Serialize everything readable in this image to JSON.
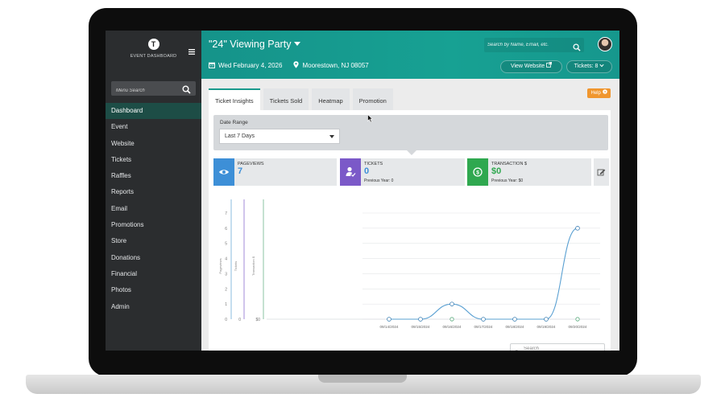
{
  "colors": {
    "accent_teal": "#17a193",
    "sidebar_bg": "#2b2d2f",
    "active_nav": "#1d4d46",
    "pageviews_blue": "#3d8fd7",
    "tickets_purple": "#7b59c8",
    "transaction_green": "#2fa84f",
    "help_orange": "#f0962e",
    "line_blue": "#5aa0d2",
    "marker_green": "#5aaa7c"
  },
  "sidebar": {
    "brand_letter": "T",
    "brand_text": "EVENT DASHBOARD",
    "menu_search_placeholder": "Menu Search",
    "items": [
      {
        "label": "Dashboard",
        "active": true
      },
      {
        "label": "Event"
      },
      {
        "label": "Website"
      },
      {
        "label": "Tickets"
      },
      {
        "label": "Raffles"
      },
      {
        "label": "Reports"
      },
      {
        "label": "Email"
      },
      {
        "label": "Promotions"
      },
      {
        "label": "Store"
      },
      {
        "label": "Donations"
      },
      {
        "label": "Financial"
      },
      {
        "label": "Photos"
      },
      {
        "label": "Admin"
      }
    ]
  },
  "header": {
    "event_title": "\"24\" Viewing Party",
    "date": "Wed February 4, 2026",
    "location": "Moorestown, NJ 08057",
    "search_placeholder": "Search by Name, Email, etc.",
    "view_website_label": "View Website",
    "tickets_label": "Tickets: 8"
  },
  "tabs": [
    {
      "label": "Ticket Insights",
      "active": true
    },
    {
      "label": "Tickets Sold"
    },
    {
      "label": "Heatmap"
    },
    {
      "label": "Promotion"
    }
  ],
  "help_label": "Help",
  "date_range": {
    "label": "Date Range",
    "selected": "Last 7 Days"
  },
  "stats": {
    "pageviews": {
      "label": "PAGEVIEWS",
      "value": "7"
    },
    "tickets": {
      "label": "TICKETS",
      "value": "0",
      "previous": "Previous Year: 0"
    },
    "transaction": {
      "label": "TRANSACTION $",
      "value": "$0",
      "previous": "Previous Year: $0"
    }
  },
  "table_search_placeholder": "Search",
  "chart_data": {
    "type": "line",
    "x": [
      "09/14/2024",
      "09/15/2024",
      "09/16/2024",
      "09/17/2024",
      "09/18/2024",
      "09/19/2024",
      "09/20/2024"
    ],
    "series": [
      {
        "name": "Pageviews",
        "values": [
          0,
          0,
          1,
          0,
          0,
          0,
          6
        ]
      },
      {
        "name": "Tickets",
        "values": [
          0,
          0,
          0,
          0,
          0,
          0,
          0
        ]
      },
      {
        "name": "Transaction $",
        "values": [
          0,
          0,
          0,
          0,
          0,
          0,
          0
        ]
      }
    ],
    "y_axes": [
      {
        "label": "Pageviews",
        "ticks": [
          "0",
          "1",
          "2",
          "3",
          "4",
          "5",
          "6",
          "7"
        ]
      },
      {
        "label": "Tickets",
        "ticks": [
          "0"
        ]
      },
      {
        "label": "Transaction $",
        "ticks": [
          "$0"
        ]
      }
    ],
    "ylim": [
      0,
      7
    ],
    "grid": true
  }
}
